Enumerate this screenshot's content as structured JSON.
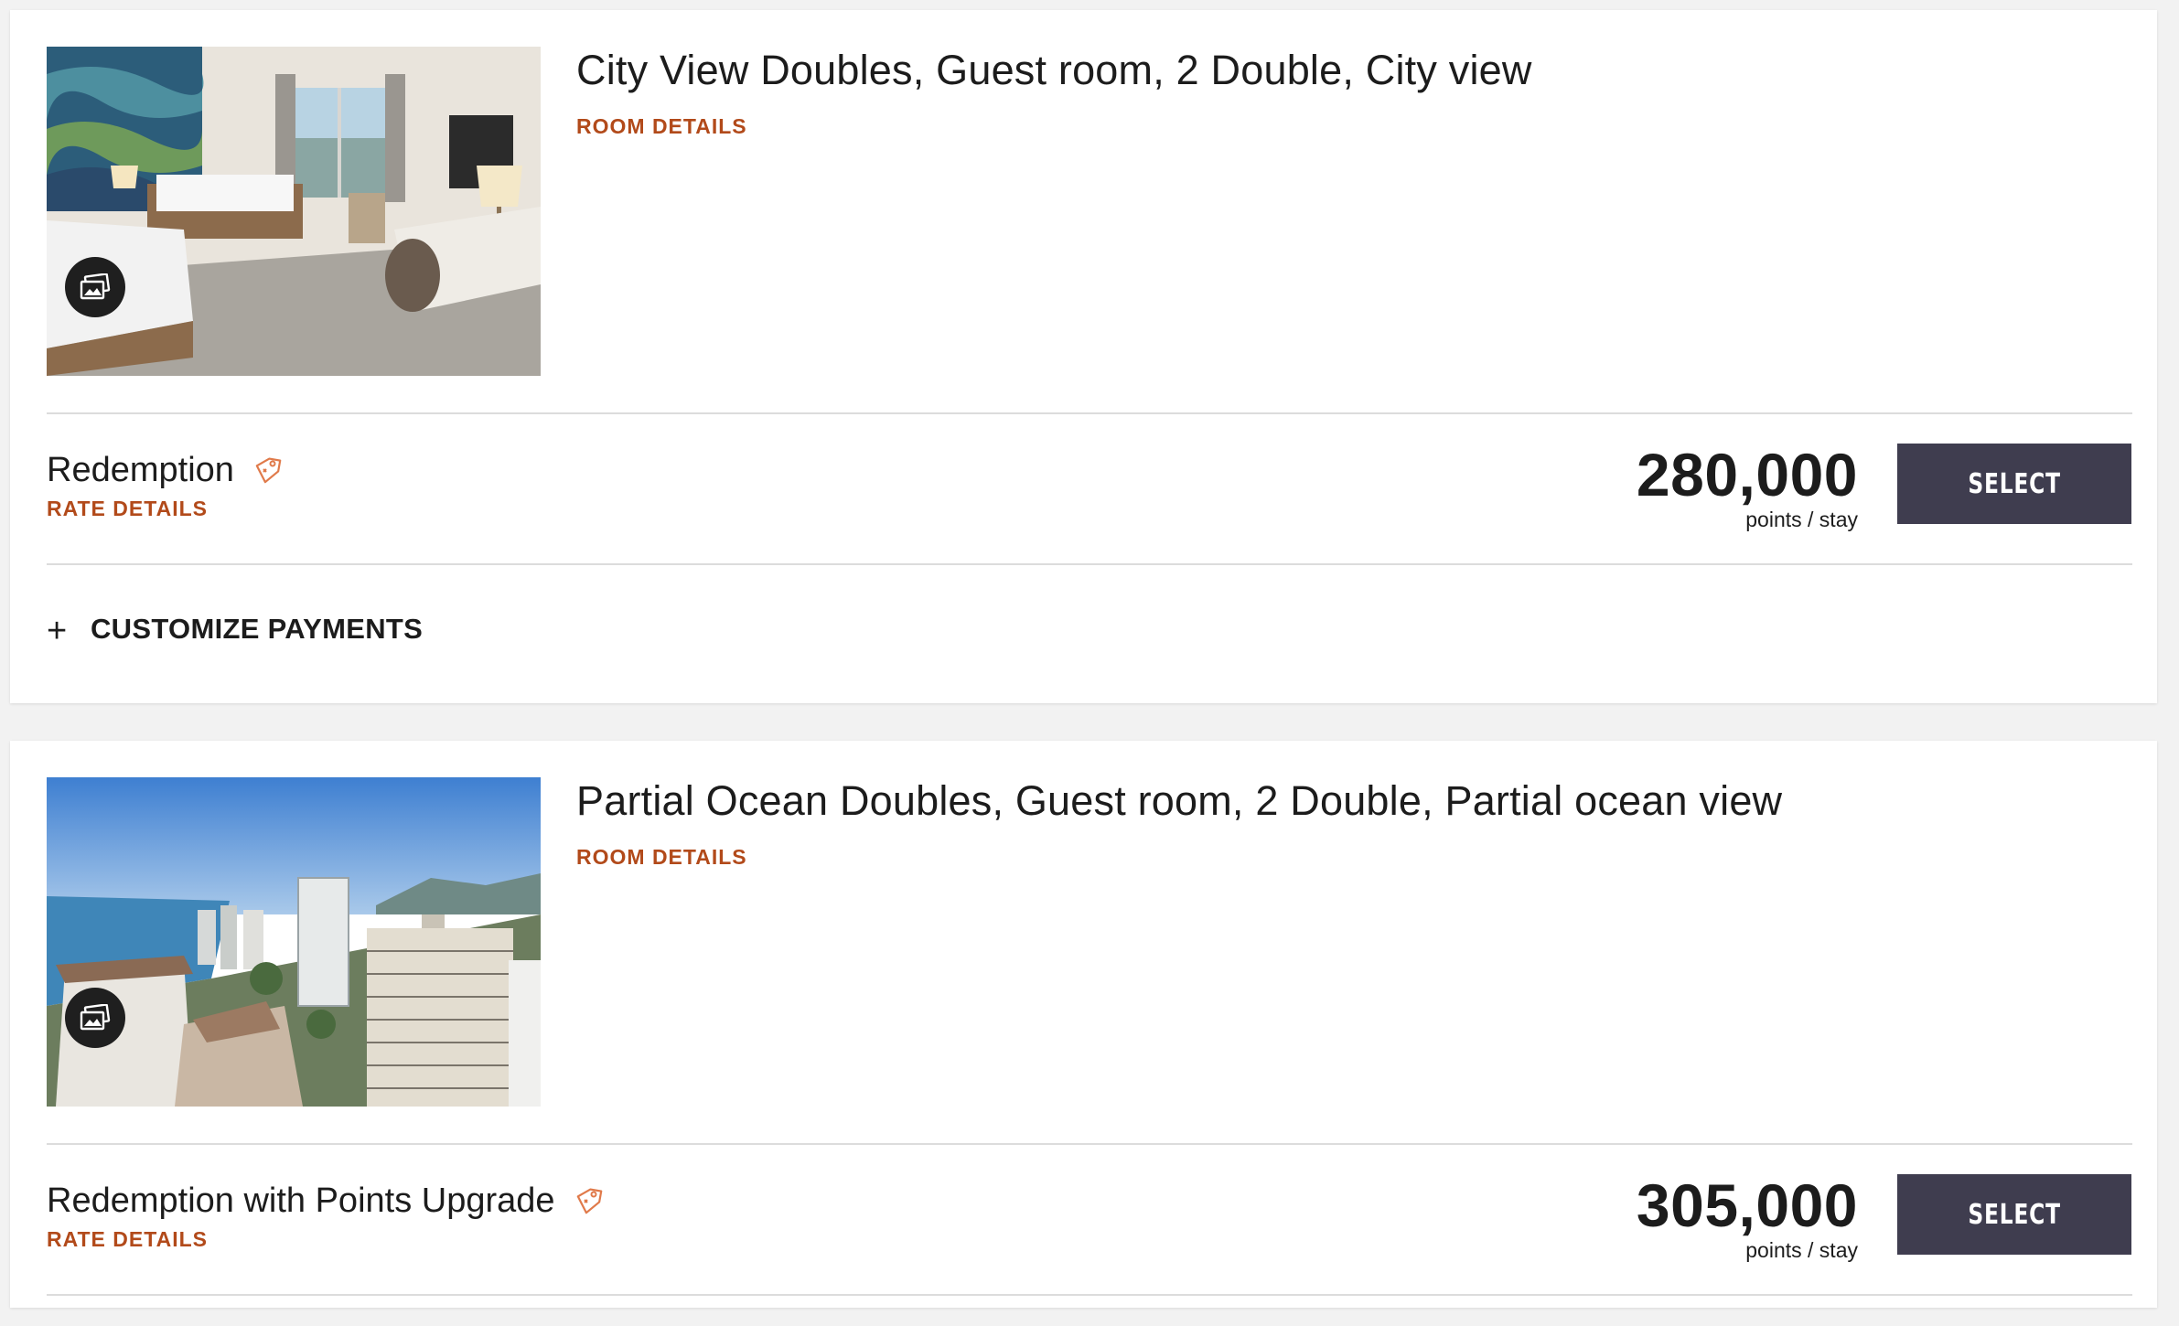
{
  "rooms": [
    {
      "title": "City View Doubles, Guest room, 2 Double, City view",
      "room_details_label": "ROOM DETAILS",
      "photo_icon": "gallery-icon",
      "rate": {
        "name": "Redemption",
        "details_label": "RATE DETAILS",
        "price": "280,000",
        "unit": "points / stay",
        "select_label": "SELECT",
        "tag_icon": "tag-icon"
      },
      "customize_label": "CUSTOMIZE PAYMENTS",
      "customize_icon": "plus-icon"
    },
    {
      "title": "Partial Ocean Doubles, Guest room, 2 Double, Partial ocean view",
      "room_details_label": "ROOM DETAILS",
      "photo_icon": "gallery-icon",
      "rate": {
        "name": "Redemption with Points Upgrade",
        "details_label": "RATE DETAILS",
        "price": "305,000",
        "unit": "points / stay",
        "select_label": "SELECT",
        "tag_icon": "tag-icon"
      }
    }
  ],
  "colors": {
    "accent_link": "#b24a1a",
    "button_bg": "#3f3d4f",
    "tag_icon": "#e07a4a",
    "page_bg": "#f2f2f2"
  },
  "plus_glyph": "+"
}
